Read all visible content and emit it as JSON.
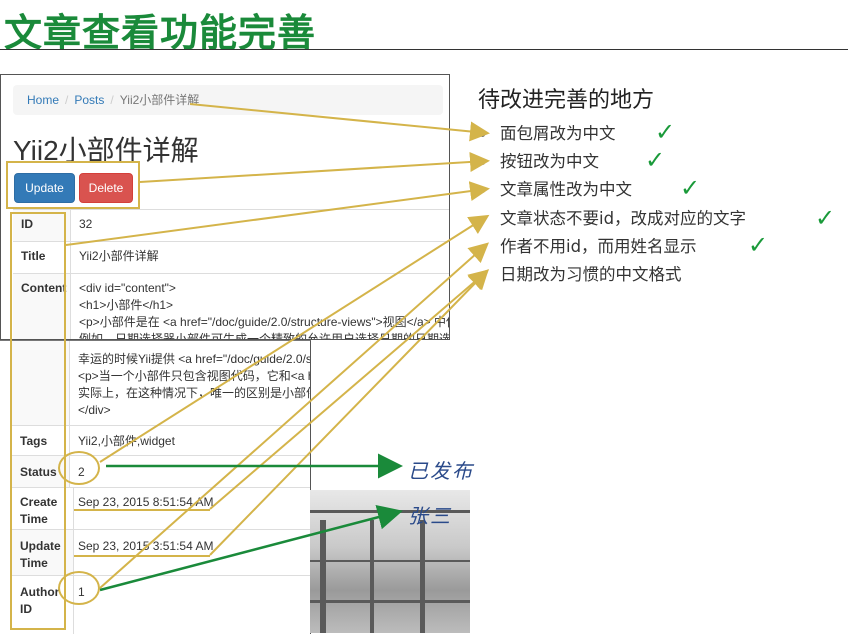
{
  "slide": {
    "title": "文章查看功能完善"
  },
  "breadcrumb": {
    "home": "Home",
    "posts": "Posts",
    "current": "Yii2小部件详解"
  },
  "post": {
    "heading": "Yii2小部件详解",
    "update_label": "Update",
    "delete_label": "Delete",
    "fields": {
      "id": {
        "label": "ID",
        "value": "32"
      },
      "title": {
        "label": "Title",
        "value": "Yii2小部件详解"
      },
      "content": {
        "label": "Content",
        "lines_top": [
          "<div id=\"content\">",
          "<h1>小部件</h1>",
          "<p>小部件是在 <a href=\"/doc/guide/2.0/structure-views\">视图</a> 中使",
          "例如，日期选择器小部件可生成一个精致的允许用户选择日期的日期选择"
        ],
        "lines_bottom": [
          "幸运的时候Yii提供 <a href=\"/doc/guide/2.0/stru",
          "<p>当一个小部件只包含视图代码，它和<a href",
          "实际上，在这种情况下，唯一的区别是小部件是",
          "</div>"
        ]
      },
      "tags": {
        "label": "Tags",
        "value": "Yii2,小部件,widget"
      },
      "status": {
        "label": "Status",
        "value": "2"
      },
      "create_time": {
        "label": "Create Time",
        "value": "Sep 23, 2015 8:51:54 AM"
      },
      "update_time": {
        "label": "Update Time",
        "value": "Sep 23, 2015 3:51:54 AM"
      },
      "author_id": {
        "label": "Author ID",
        "value": "1"
      }
    }
  },
  "panel": {
    "title": "待改进完善的地方",
    "items": [
      {
        "text": "面包屑改为中文",
        "done": true
      },
      {
        "text": "按钮改为中文",
        "done": true
      },
      {
        "text": "文章属性改为中文",
        "done": true
      },
      {
        "text": "文章状态不要id，改成对应的文字",
        "done": true
      },
      {
        "text": "作者不用id，而用姓名显示",
        "done": true
      },
      {
        "text": "日期改为习惯的中文格式",
        "done": false
      }
    ],
    "check_glyph": "✓"
  },
  "annotations": {
    "status_note": "已发布",
    "author_note": "张三"
  },
  "colors": {
    "title_green": "#1a8a3a",
    "highlight_gold": "#d4b44a",
    "arrow_green": "#1a8a3a",
    "check_green": "#1a9a3a",
    "link_blue": "#337ab7",
    "delete_red": "#d9534f"
  }
}
